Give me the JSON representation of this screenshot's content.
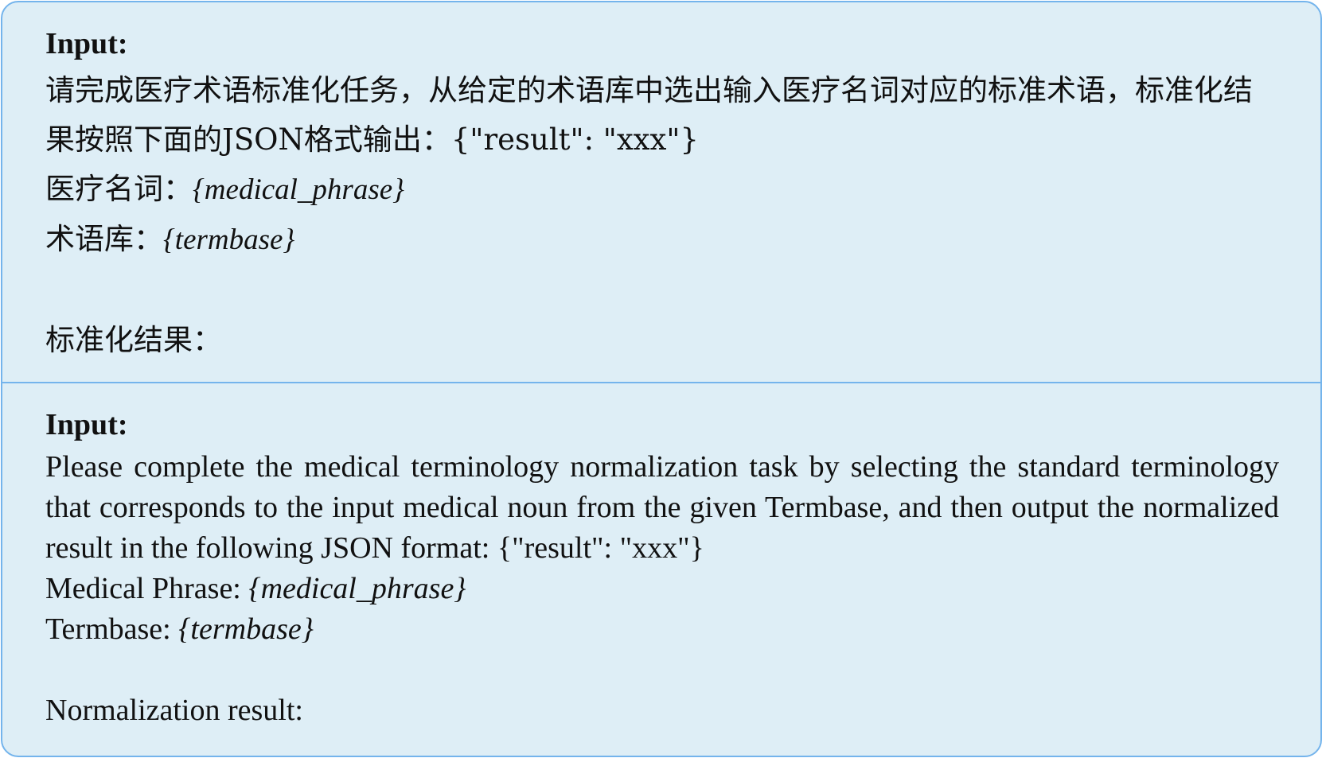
{
  "zh": {
    "heading": "Input:",
    "instruction": "请完成医疗术语标准化任务，从给定的术语库中选出输入医疗名词对应的标准术语，标准化结果按照下面的JSON格式输出：{\"result\": \"xxx\"}",
    "phrase_label": "医疗名词：",
    "phrase_var": "{medical_phrase}",
    "termbase_label": "术语库：",
    "termbase_var": "{termbase}",
    "result_label": "标准化结果："
  },
  "en": {
    "heading": "Input:",
    "instruction": "Please complete the medical terminology normalization task by selecting the standard terminology that corresponds to the input medical noun from the given Termbase, and then output the normalized result in the following JSON format: {\"result\": \"xxx\"}",
    "phrase_label": "Medical Phrase: ",
    "phrase_var": "{medical_phrase}",
    "termbase_label": "Termbase: ",
    "termbase_var": "{termbase}",
    "result_label": "Normalization result:"
  },
  "colors": {
    "border": "#74b4ec",
    "background": "#deeef6"
  }
}
